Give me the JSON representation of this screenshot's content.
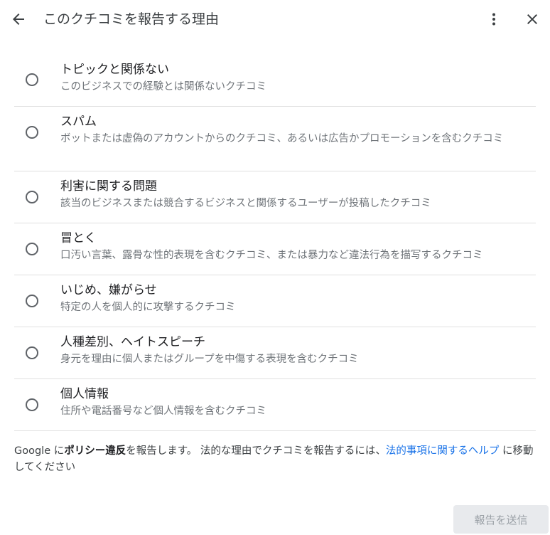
{
  "header": {
    "title": "このクチコミを報告する理由"
  },
  "icons": {
    "back": "arrow-back-icon",
    "more": "more-vert-icon",
    "close": "close-icon"
  },
  "options": [
    {
      "title": "トピックと関係ない",
      "description": "このビジネスでの経験とは関係ないクチコミ"
    },
    {
      "title": "スパム",
      "description": "ボットまたは虚偽のアカウントからのクチコミ、あるいは広告かプロモーションを含むクチコミ"
    },
    {
      "title": "利害に関する問題",
      "description": "該当のビジネスまたは競合するビジネスと関係するユーザーが投稿したクチコミ"
    },
    {
      "title": "冒とく",
      "description": "口汚い言葉、露骨な性的表現を含むクチコミ、または暴力など違法行為を描写するクチコミ"
    },
    {
      "title": "いじめ、嫌がらせ",
      "description": "特定の人を個人的に攻撃するクチコミ"
    },
    {
      "title": "人種差別、ヘイトスピーチ",
      "description": "身元を理由に個人またはグループを中傷する表現を含むクチコミ"
    },
    {
      "title": "個人情報",
      "description": "住所や電話番号など個人情報を含むクチコミ"
    }
  ],
  "footer": {
    "prefix": "Google に",
    "bold": "ポリシー違反",
    "middle": "を報告します。 法的な理由でクチコミを報告するには、",
    "link": "法的事項に関するヘルプ",
    "suffix": " に移動してください"
  },
  "submit_label": "報告を送信",
  "colors": {
    "link": "#1a73e8",
    "disabled_bg": "#e8eaed",
    "disabled_text": "#9aa0a6",
    "divider": "#e0e0e0"
  }
}
